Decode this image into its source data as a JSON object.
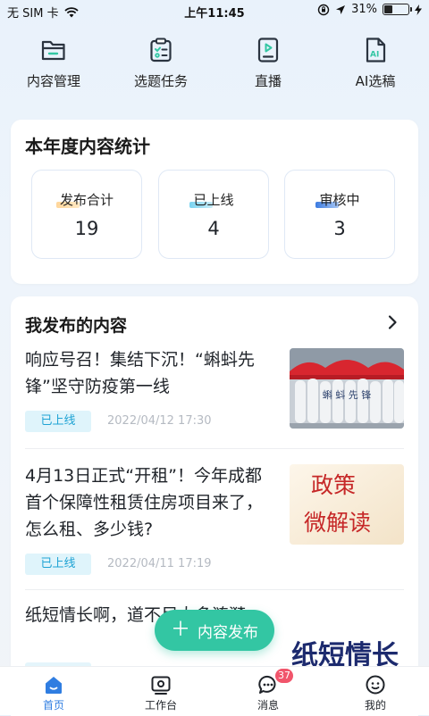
{
  "status_bar": {
    "carrier": "无 SIM 卡",
    "time": "上午11:45",
    "battery_percent": "31%",
    "battery_level": 0.31
  },
  "quick_nav": [
    {
      "label": "内容管理",
      "icon": "folder-icon"
    },
    {
      "label": "选题任务",
      "icon": "clipboard-task-icon"
    },
    {
      "label": "直播",
      "icon": "live-play-icon"
    },
    {
      "label": "AI选稿",
      "icon": "ai-document-icon"
    }
  ],
  "stats": {
    "title": "本年度内容统计",
    "items": [
      {
        "label": "发布合计",
        "value": "19"
      },
      {
        "label": "已上线",
        "value": "4"
      },
      {
        "label": "审核中",
        "value": "3"
      }
    ]
  },
  "my_content": {
    "title": "我发布的内容",
    "items": [
      {
        "title": "响应号召！集结下沉！“蝌蚪先锋”坚守防疫第一线",
        "status": "已上线",
        "time": "2022/04/12 17:30",
        "thumb_text": "蝌 蚪 先 锋"
      },
      {
        "title": "4月13日正式“开租”！今年成都首个保障性租赁住房项目来了，怎么租、多少钱?",
        "status": "已上线",
        "time": "2022/04/11 17:19",
        "thumb_line1": "政策",
        "thumb_line2": "微解读"
      },
      {
        "title": "纸短情长啊，道不尽太多涟漪",
        "status": "",
        "time": "",
        "thumb_text": "纸短情长"
      }
    ]
  },
  "fab": {
    "label": "内容发布"
  },
  "tab_bar": [
    {
      "label": "首页",
      "icon": "home-icon",
      "active": true
    },
    {
      "label": "工作台",
      "icon": "workbench-icon",
      "active": false
    },
    {
      "label": "消息",
      "icon": "message-icon",
      "active": false,
      "badge": "37"
    },
    {
      "label": "我的",
      "icon": "profile-icon",
      "active": false
    }
  ],
  "colors": {
    "accent": "#2f7de1",
    "fab": "#33c6a3",
    "badge_text": "#1fa3d4",
    "msg_badge": "#f1556b"
  }
}
